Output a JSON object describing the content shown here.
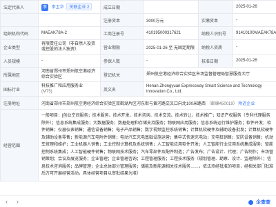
{
  "rows": [
    {
      "c1_label": "法定代表人",
      "c2_value_prefix": "李",
      "c2_name": "李卫华",
      "c2_badge": "关联企业 2",
      "c3_label": "成立日期",
      "c4_value": "",
      "c5_label": "",
      "c6_value": "2025-01-26"
    },
    {
      "c1_label": "",
      "c2_value": "",
      "c3_label": "注册资本",
      "c4_value": "3000万元",
      "c5_label": "实缴资本",
      "c6_value": "-"
    },
    {
      "c1_label": "组织机构代码",
      "c2_value": "MAEAK78A-2",
      "c3_label": "工商注册号",
      "c4_value": "410195000317621",
      "c5_label": "纳税人识别号",
      "c6_value": "91410100MAEAK78A2Y"
    },
    {
      "c1_label": "企业类型",
      "c2_value": "有限责任公司（非自然人投资或控股的法人独资）",
      "c3_label": "营业期限",
      "c4_value": "2025-01-26 至 无固定期限",
      "c5_label": "纳税人资质",
      "c6_value": "-"
    },
    {
      "c1_label": "人员规模",
      "c2_value": "-",
      "c3_label": "参保人数",
      "c4_value": "-",
      "c5_label": "核准日期",
      "c6_value": "2025-01-26"
    },
    {
      "c1_label": "所属地区",
      "c2_value": "河南省郑州市郑州航空港经济综合实验区",
      "c3_label": "登记机关",
      "c4_value": "郑州航空港经济综合实验区市场监督管理局智慧服务大厅",
      "c5_label": "",
      "c6_value": ""
    },
    {
      "c1_label": "国标行业",
      "c2_value": "科技推广和应用服务业",
      "c2_sub": "(M75)",
      "c3_label": "英文名",
      "c4_value": "Henan Zhongyuan Expressway Smart Science and Technology Innovation Co., Ltd.",
      "c5_label": "",
      "c6_value": ""
    }
  ],
  "address": {
    "label": "注册地址",
    "value": "河南省郑州市郑州航空港经济综合实验区双鹤湖片区河东街与黄河路交叉口向北100米路西",
    "tail": "（邮编450019）",
    "nearby": "附近企业"
  },
  "scope": {
    "label": "经营范围",
    "text": "一般项目：[创业空间服务；技术服务、技术开发、技术咨询、技术交流、技术转让、技术推广；知识产权服务（专利代理服务除外）；信息系统集成服务；大数据服务；数据处理和存储支持服务；物联网应用服务；信息系统运行维护服务；软件开发；软件销售；仪器仪表销售；通信设备销售；电子产品销售；数字视频监控系统销售；计算机软硬件及辅助设备批发；计算机软硬件及辅助设备零售；新能源汽车电附件销售；电动汽车充电基础设施运营；集中式快速充电站；充电桩销售；安防设备销售；机动车修理和维护；工业机器人销售；工业控制计算机及系统销售；人工智能应用软件开发；人工智能行业应用系统集成服务；智能控制系统集成；人工智能硬件销售；物联网技术服务；汽车零部件及配件制造；广告发布；广告设计、代理；广告制作；市场营销策划；会议及展览服务；企业管理；企业管理咨询；工程管理服务；工程技术服务（规划管理、勘察、设计、监理除外）；信息技术咨询服务；品牌管理；企业总体部分管理服务；储能及新能源相关技术服务……，依法须经批准的项目，经相关部门批准后方可开展经营活动，具体经营项目以审批结果为准）"
  },
  "footer": {
    "prev_icon": "chevron-left-icon",
    "next_icon": "chevron-right-icon",
    "brand": "企查查"
  }
}
